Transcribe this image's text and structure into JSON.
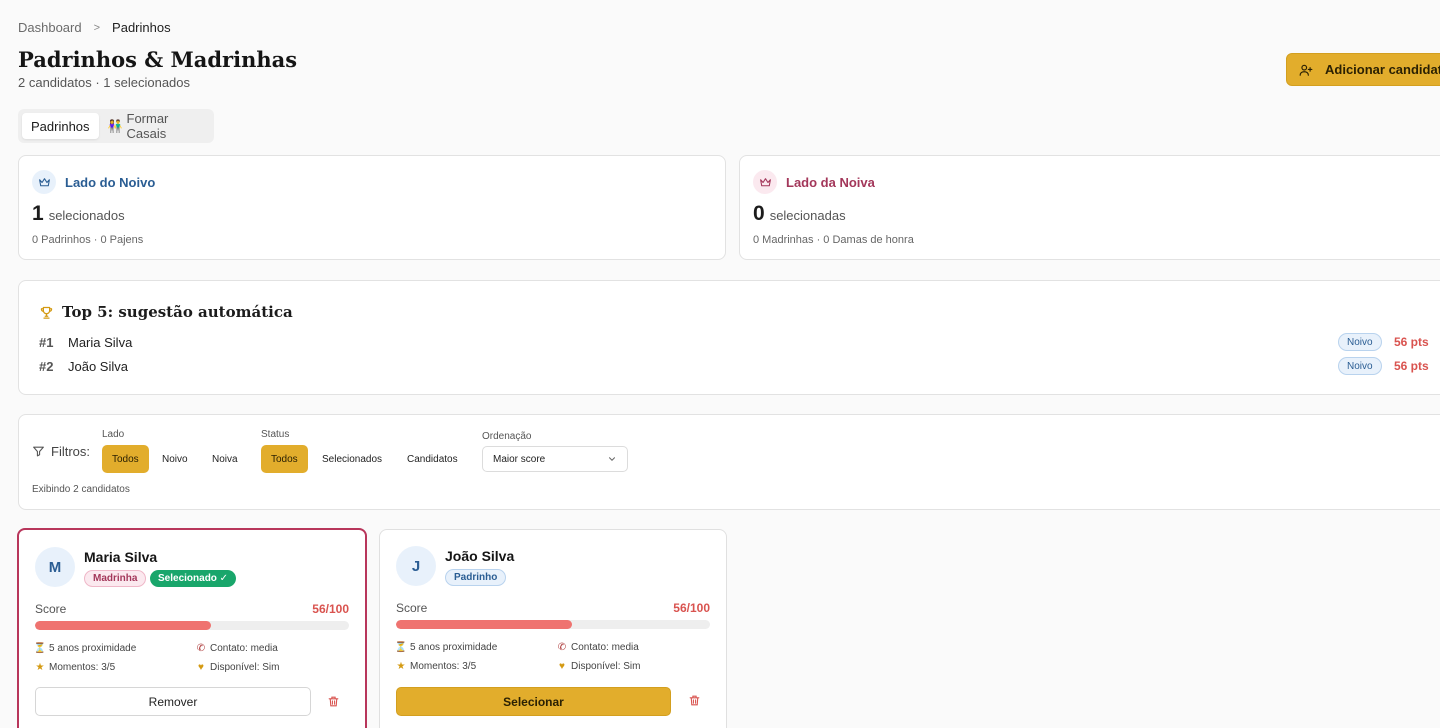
{
  "breadcrumb": {
    "root": "Dashboard",
    "current": "Padrinhos"
  },
  "header": {
    "title": "Padrinhos & Madrinhas",
    "subtitle": "2 candidatos · 1 selecionados",
    "add_button": "Adicionar candidato"
  },
  "tabs": [
    {
      "label": "Padrinhos",
      "active": true
    },
    {
      "label": "Formar Casais",
      "icon": "couple-icon",
      "emoji": "👫",
      "active": false
    }
  ],
  "sides": {
    "noivo": {
      "title": "Lado do Noivo",
      "count": "1",
      "count_label": "selecionados",
      "details": "0 Padrinhos · 0 Pajens",
      "color": "#2a5d93"
    },
    "noiva": {
      "title": "Lado da Noiva",
      "count": "0",
      "count_label": "selecionadas",
      "details": "0 Madrinhas · 0 Damas de honra",
      "color": "#a3375a"
    }
  },
  "top5": {
    "title": "Top 5: sugestão automática",
    "rows": [
      {
        "rank": "#1",
        "name": "Maria Silva",
        "side": "Noivo",
        "points": "56 pts"
      },
      {
        "rank": "#2",
        "name": "João Silva",
        "side": "Noivo",
        "points": "56 pts"
      }
    ]
  },
  "filters": {
    "label": "Filtros:",
    "lado": {
      "label": "Lado",
      "options": [
        "Todos",
        "Noivo",
        "Noiva"
      ],
      "selected": "Todos"
    },
    "status": {
      "label": "Status",
      "options": [
        "Todos",
        "Selecionados",
        "Candidatos"
      ],
      "selected": "Todos"
    },
    "ordenacao": {
      "label": "Ordenação",
      "value": "Maior score"
    },
    "count_text": "Exibindo 2 candidatos"
  },
  "candidates": [
    {
      "initial": "M",
      "name": "Maria Silva",
      "role": "Madrinha",
      "selected": true,
      "selected_label": "Selecionado ✓",
      "score_label": "Score",
      "score": "56/100",
      "score_fraction": 0.56,
      "proximity": "5 anos proximidade",
      "contact": "Contato: media",
      "moments": "Momentos: 3/5",
      "available": "Disponível: Sim",
      "action": "Remover"
    },
    {
      "initial": "J",
      "name": "João Silva",
      "role": "Padrinho",
      "selected": false,
      "score_label": "Score",
      "score": "56/100",
      "score_fraction": 0.56,
      "proximity": "5 anos proximidade",
      "contact": "Contato: media",
      "moments": "Momentos: 3/5",
      "available": "Disponível: Sim",
      "action": "Selecionar"
    }
  ],
  "colors": {
    "accent": "#e2ad2c",
    "danger": "#d9534f",
    "selected_border": "#b8365b",
    "success": "#19a66b"
  }
}
